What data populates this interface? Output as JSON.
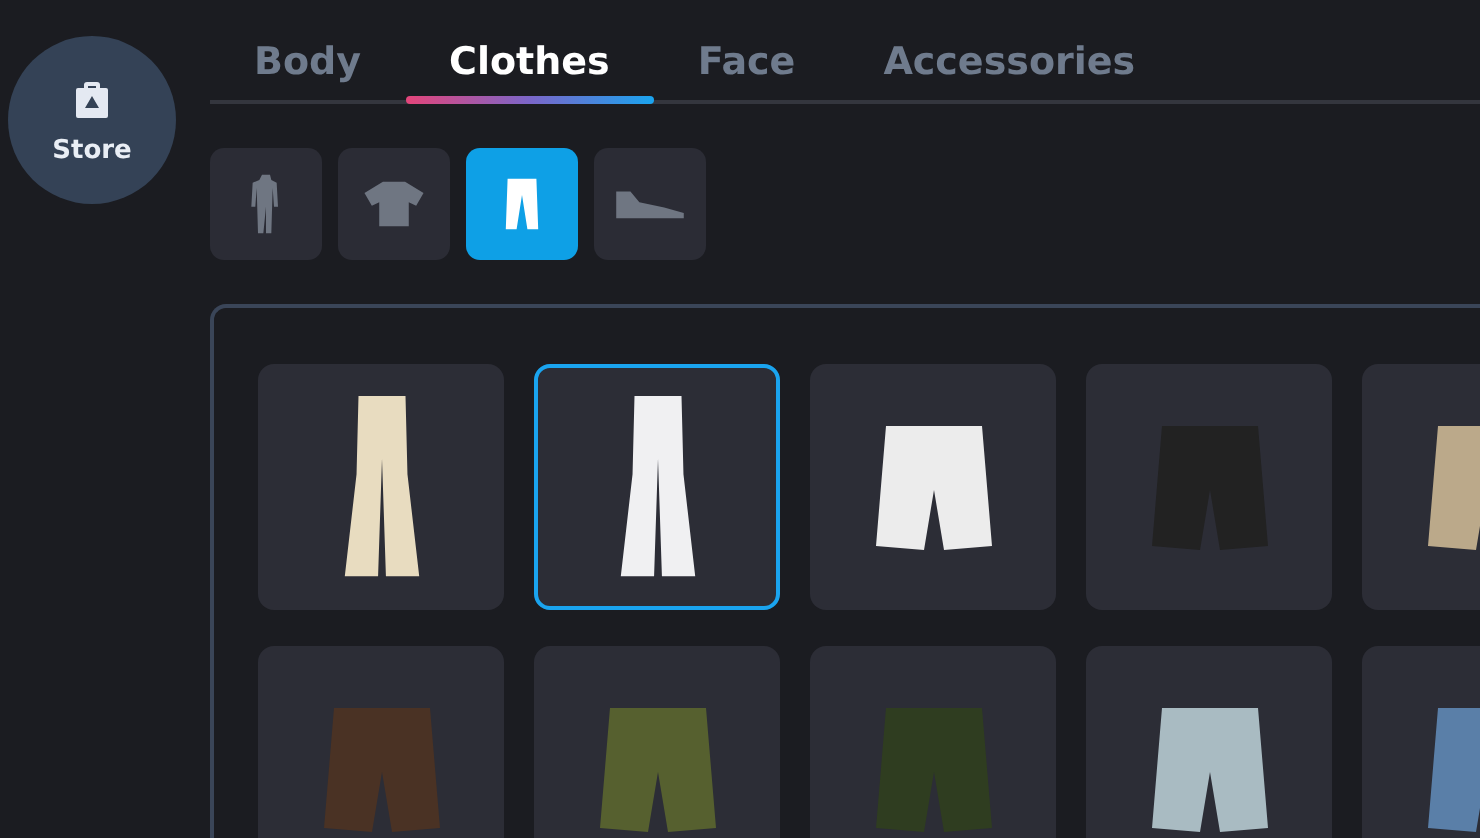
{
  "store_button": {
    "label": "Store"
  },
  "tabs": [
    {
      "label": "Body",
      "selected": false
    },
    {
      "label": "Clothes",
      "selected": true
    },
    {
      "label": "Face",
      "selected": false
    },
    {
      "label": "Accessories",
      "selected": false
    }
  ],
  "categories": [
    {
      "kind": "outfit",
      "selected": false
    },
    {
      "kind": "shirt",
      "selected": false
    },
    {
      "kind": "pants",
      "selected": true
    },
    {
      "kind": "shoes",
      "selected": false
    }
  ],
  "items": [
    {
      "kind": "flared-pants",
      "color": "#e8dcc0",
      "selected": false
    },
    {
      "kind": "flared-pants",
      "color": "#f0f0f2",
      "selected": true
    },
    {
      "kind": "shorts",
      "color": "#ececec",
      "selected": false
    },
    {
      "kind": "shorts",
      "color": "#222222",
      "selected": false
    },
    {
      "kind": "shorts",
      "color": "#bba98a",
      "selected": false
    },
    {
      "kind": "shorts",
      "color": "#4a3224",
      "selected": false
    },
    {
      "kind": "shorts",
      "color": "#56602f",
      "selected": false
    },
    {
      "kind": "shorts",
      "color": "#2f3d20",
      "selected": false
    },
    {
      "kind": "shorts",
      "color": "#a9bbc2",
      "selected": false
    },
    {
      "kind": "shorts",
      "color": "#5a7fa8",
      "selected": false
    }
  ]
}
